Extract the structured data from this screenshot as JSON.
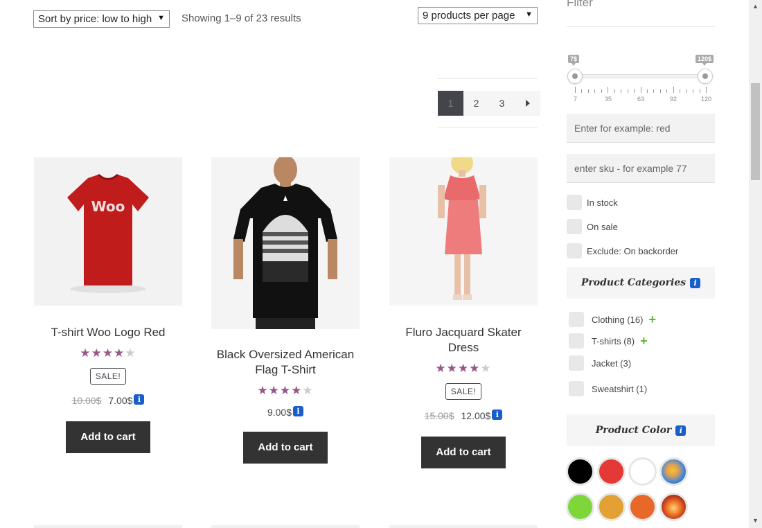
{
  "toolbar": {
    "sort_value": "Sort by price: low to high",
    "result_count": "Showing 1–9 of 23 results",
    "per_page_value": "9 products per page"
  },
  "pagination": {
    "pages": [
      "1",
      "2",
      "3"
    ],
    "current": "1"
  },
  "products": [
    {
      "title": "T-shirt Woo Logo Red",
      "rating": 4,
      "sale": "SALE!",
      "old_price": "10.00$",
      "price": "7.00$",
      "button": "Add to cart",
      "shirt_text": "Woo"
    },
    {
      "title": "Black Oversized American Flag T-Shirt",
      "rating": 4,
      "price": "9.00$",
      "button": "Add to cart"
    },
    {
      "title": "Fluro Jacquard Skater Dress",
      "rating": 4,
      "sale": "SALE!",
      "old_price": "15.00$",
      "price": "12.00$",
      "button": "Add to cart"
    }
  ],
  "sidebar": {
    "filter_title": "Filter",
    "price_slider": {
      "min_label": "7$",
      "max_label": "120$",
      "ticks": [
        "7",
        "35",
        "63",
        "92",
        "120"
      ]
    },
    "text_search_placeholder": "Enter for example: red",
    "sku_placeholder": "enter sku - for example 77",
    "checks": [
      "In stock",
      "On sale",
      "Exclude: On backorder"
    ],
    "categories_title": "Product Categories",
    "categories": [
      {
        "label": "Clothing (16)",
        "expandable": true
      },
      {
        "label": "T-shirts (8)",
        "expandable": true
      },
      {
        "label": "Jacket (3)",
        "expandable": false
      },
      {
        "label": "Sweatshirt (1)",
        "expandable": false
      }
    ],
    "color_title": "Product Color",
    "colors": [
      "#000000",
      "#e53935",
      "#ffffff",
      "image",
      "#7ed63a",
      "#e3a033",
      "#e8682a",
      "image"
    ]
  },
  "icons": {
    "info": "i",
    "plus": "+",
    "arrow_down": "▼"
  }
}
